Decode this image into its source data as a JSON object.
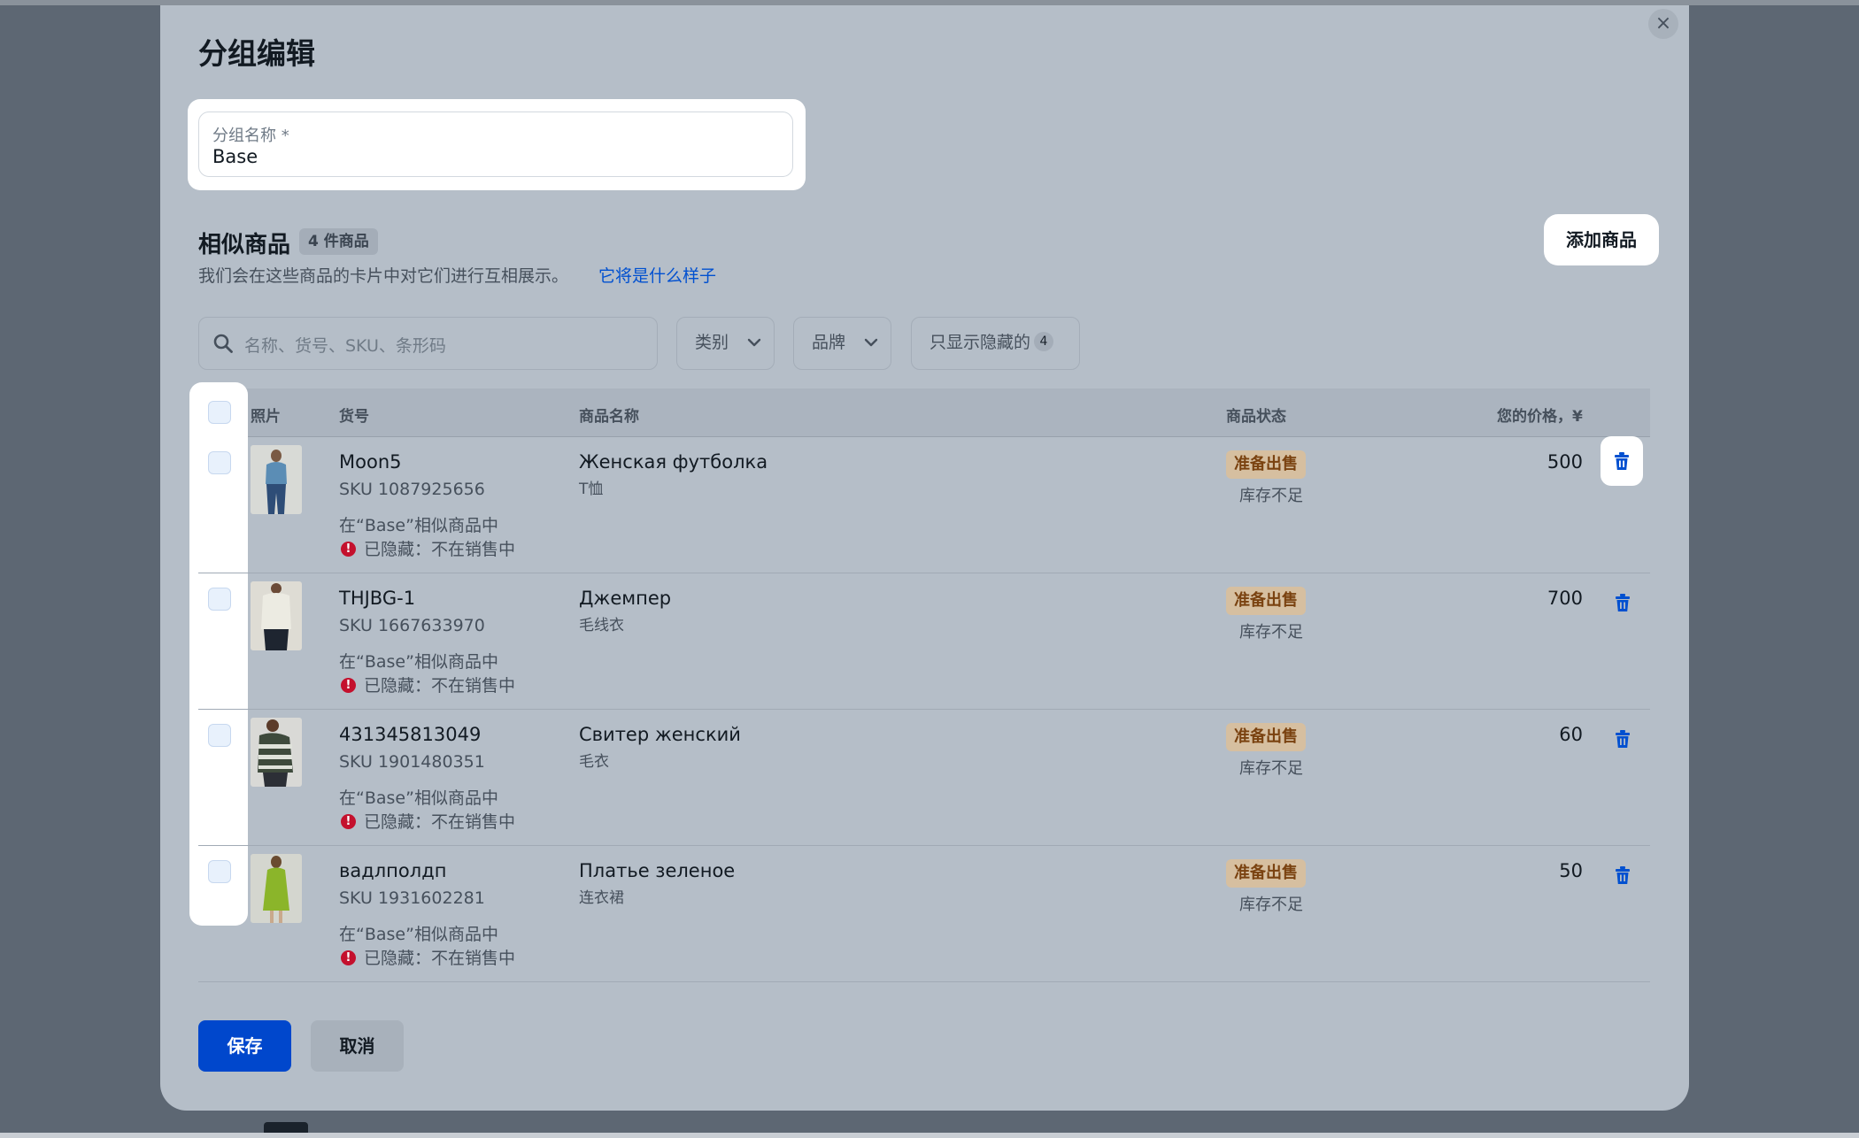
{
  "dialog": {
    "title": "分组编辑",
    "close_label": "×"
  },
  "group_name": {
    "label": "分组名称 *",
    "value": "Base"
  },
  "similar": {
    "title": "相似商品",
    "count_badge": "4 件商品",
    "description": "我们会在这些商品的卡片中对它们进行互相展示。",
    "preview_link": "它将是什么样子",
    "add_button": "添加商品"
  },
  "filters": {
    "search_placeholder": "名称、货号、SKU、条形码",
    "category": "类别",
    "brand": "品牌",
    "hidden_only": "只显示隐藏的",
    "hidden_count": "4"
  },
  "table": {
    "headers": {
      "photo": "照片",
      "article": "货号",
      "name": "商品名称",
      "status": "商品状态",
      "price": "您的价格，¥"
    },
    "rows": [
      {
        "article": "Moon5",
        "sku": "SKU 1087925656",
        "group_note": "在“Base”相似商品中",
        "hidden_note": "已隐藏：不在销售中",
        "name": "Женская футболка",
        "category": "T恤",
        "status": "准备出售",
        "stock": "库存不足",
        "price": "500"
      },
      {
        "article": "THJBG-1",
        "sku": "SKU 1667633970",
        "group_note": "在“Base”相似商品中",
        "hidden_note": "已隐藏：不在销售中",
        "name": "Джемпер",
        "category": "毛线衣",
        "status": "准备出售",
        "stock": "库存不足",
        "price": "700"
      },
      {
        "article": "431345813049",
        "sku": "SKU 1901480351",
        "group_note": "在“Base”相似商品中",
        "hidden_note": "已隐藏：不在销售中",
        "name": "Свитер женский",
        "category": "毛衣",
        "status": "准备出售",
        "stock": "库存不足",
        "price": "60"
      },
      {
        "article": "вадлполдп",
        "sku": "SKU 1931602281",
        "group_note": "在“Base”相似商品中",
        "hidden_note": "已隐藏：不在销售中",
        "name": "Платье зеленое",
        "category": "连衣裙",
        "status": "准备出售",
        "stock": "库存不足",
        "price": "50"
      }
    ]
  },
  "footer": {
    "save": "保存",
    "cancel": "取消"
  },
  "colors": {
    "overlay": "#5d6773",
    "primary_button": "#0047cc",
    "link": "#0050d0",
    "status_badge": "#d6bfa0",
    "warning": "#c4102d",
    "delete_icon": "#0050d0"
  },
  "icons": [
    "close-icon",
    "search-icon",
    "chevron-down-icon",
    "trash-icon",
    "warning-icon"
  ]
}
